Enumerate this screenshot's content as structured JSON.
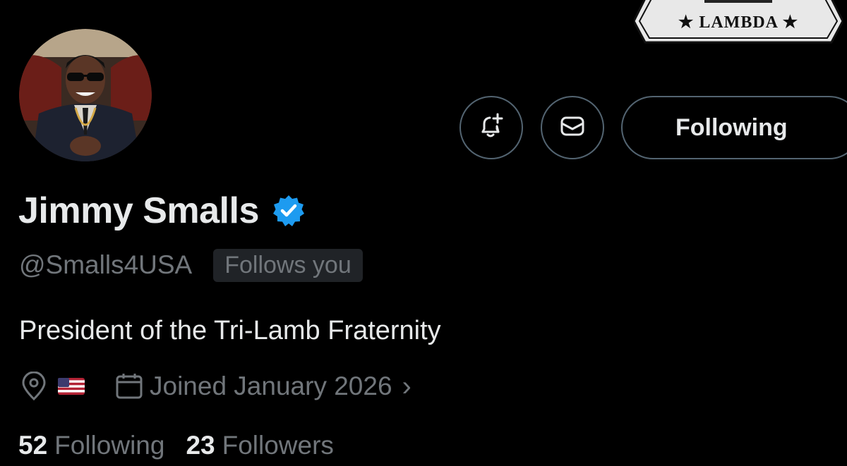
{
  "banner": {
    "badge_text": "★ LAMBDA ★"
  },
  "profile": {
    "display_name": "Jimmy Smalls",
    "handle": "@Smalls4USA",
    "follows_you_label": "Follows you",
    "bio": "President of the Tri-Lamb Fraternity",
    "location_flag": "🇺🇸",
    "joined": "Joined January 2026",
    "verified": true
  },
  "actions": {
    "notify_icon": "bell-plus-icon",
    "message_icon": "envelope-icon",
    "follow_label": "Following"
  },
  "stats": {
    "following_count": "52",
    "following_label": "Following",
    "followers_count": "23",
    "followers_label": "Followers"
  },
  "colors": {
    "background": "#000000",
    "text_primary": "#e7e9ea",
    "text_secondary": "#71767b",
    "verified_blue": "#1d9bf0",
    "border": "#536471"
  }
}
